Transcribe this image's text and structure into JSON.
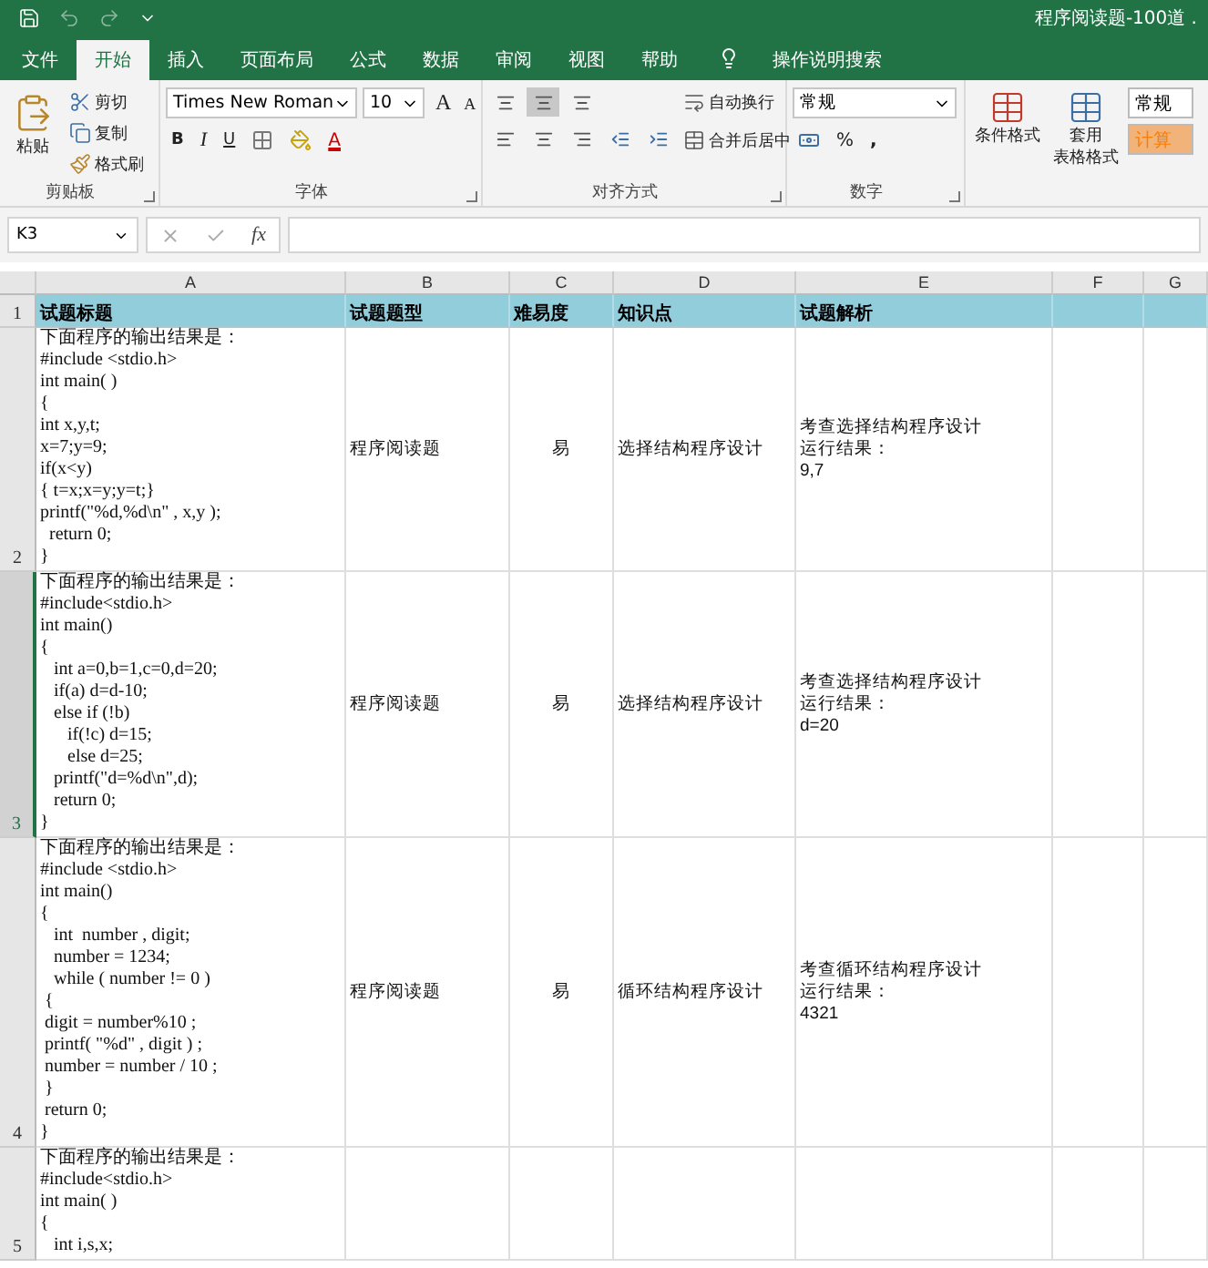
{
  "window": {
    "title": "程序阅读题-100道 ."
  },
  "tabs": [
    {
      "label": "文件",
      "selected": false
    },
    {
      "label": "开始",
      "selected": true
    },
    {
      "label": "插入",
      "selected": false
    },
    {
      "label": "页面布局",
      "selected": false
    },
    {
      "label": "公式",
      "selected": false
    },
    {
      "label": "数据",
      "selected": false
    },
    {
      "label": "审阅",
      "selected": false
    },
    {
      "label": "视图",
      "selected": false
    },
    {
      "label": "帮助",
      "selected": false
    }
  ],
  "tell_me": "操作说明搜索",
  "ribbon": {
    "clipboard": {
      "paste": "粘贴",
      "cut": "剪切",
      "copy": "复制",
      "format_painter": "格式刷",
      "label": "剪贴板"
    },
    "font": {
      "name": "Times New Roman",
      "size": "10",
      "bold": "B",
      "italic": "I",
      "underline": "U",
      "grow": "A",
      "shrink": "A",
      "font_color": "A",
      "label": "字体"
    },
    "alignment": {
      "vertical": [
        {
          "selected": false
        },
        {
          "selected": true
        },
        {
          "selected": false
        }
      ],
      "wrap": "自动换行",
      "merge": "合并后居中",
      "label": "对齐方式"
    },
    "number": {
      "format": "常规",
      "percent": "%",
      "comma": ",",
      "label": "数字"
    },
    "styles": {
      "conditional": "条件格式",
      "table_line1": "套用",
      "table_line2": "表格格式",
      "normal": "常规",
      "calc": "计算"
    }
  },
  "formula_bar": {
    "name_box": "K3",
    "fx": "fx"
  },
  "columns": [
    "A",
    "B",
    "C",
    "D",
    "E",
    "F",
    "G"
  ],
  "header_row": {
    "number": "1",
    "cells": [
      "试题标题",
      "试题题型",
      "难易度",
      "知识点",
      "试题解析"
    ]
  },
  "rows": [
    {
      "number": "2",
      "selected": false,
      "title": [
        "下面程序的输出结果是：",
        "#include <stdio.h>",
        "int main( )",
        "{",
        "int x,y,t;",
        "x=7;y=9;",
        "if(x<y)",
        "{ t=x;x=y;y=t;}",
        "printf(\"%d,%d\\n\" , x,y );",
        "  return 0;",
        "}"
      ],
      "type": "程序阅读题",
      "difficulty": "易",
      "topic": "选择结构程序设计",
      "analysis": [
        "考查选择结构程序设计",
        "运行结果：",
        "9,7"
      ]
    },
    {
      "number": "3",
      "selected": true,
      "title": [
        "下面程序的输出结果是：",
        "#include<stdio.h>",
        "int main()",
        "{",
        "   int a=0,b=1,c=0,d=20;",
        "   if(a) d=d-10;",
        "   else if (!b)",
        "      if(!c) d=15;",
        "      else d=25;",
        "   printf(\"d=%d\\n\",d);",
        "   return 0;",
        "}"
      ],
      "type": "程序阅读题",
      "difficulty": "易",
      "topic": "选择结构程序设计",
      "analysis": [
        "考查选择结构程序设计",
        "运行结果：",
        "d=20"
      ]
    },
    {
      "number": "4",
      "selected": false,
      "title": [
        "下面程序的输出结果是：",
        "#include <stdio.h>",
        "int main()",
        "{",
        "   int  number , digit;",
        "   number = 1234;",
        "   while ( number != 0 )",
        " {",
        " digit = number%10 ;",
        " printf( \"%d\" , digit ) ;",
        " number = number / 10 ;",
        " }",
        " return 0;",
        "}"
      ],
      "type": "程序阅读题",
      "difficulty": "易",
      "topic": "循环结构程序设计",
      "analysis": [
        "考查循环结构程序设计",
        "运行结果：",
        "4321"
      ]
    },
    {
      "number": "5",
      "selected": false,
      "title": [
        "下面程序的输出结果是：",
        "#include<stdio.h>",
        "int main( )",
        "{",
        "   int i,s,x;"
      ]
    }
  ]
}
